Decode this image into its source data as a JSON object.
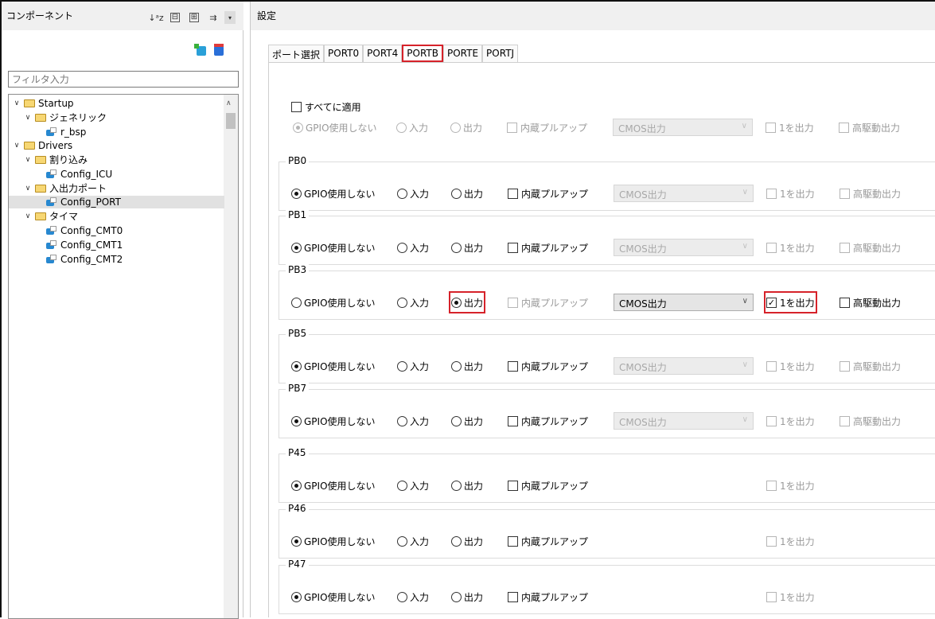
{
  "left_panel": {
    "title": "コンポーネント",
    "toolbar": {
      "sort": "↓ᵃz",
      "collapse": "⊟",
      "expand": "⊞",
      "link": "⇉",
      "menu": "▾"
    },
    "filter_placeholder": "フィルタ入力",
    "tree": [
      {
        "label": "Startup",
        "type": "folder"
      },
      {
        "label": "ジェネリック",
        "type": "folder"
      },
      {
        "label": "r_bsp",
        "type": "component"
      },
      {
        "label": "Drivers",
        "type": "folder"
      },
      {
        "label": "割り込み",
        "type": "folder"
      },
      {
        "label": "Config_ICU",
        "type": "component"
      },
      {
        "label": "入出力ポート",
        "type": "folder"
      },
      {
        "label": "Config_PORT",
        "type": "component",
        "selected": true
      },
      {
        "label": "タイマ",
        "type": "folder"
      },
      {
        "label": "Config_CMT0",
        "type": "component"
      },
      {
        "label": "Config_CMT1",
        "type": "component"
      },
      {
        "label": "Config_CMT2",
        "type": "component"
      }
    ]
  },
  "right_panel": {
    "title": "設定",
    "tabs": [
      "ポート選択",
      "PORT0",
      "PORT4",
      "PORTB",
      "PORTE",
      "PORTJ"
    ],
    "active_tab": "PORTB",
    "apply_all": {
      "label": "すべてに適用",
      "mode_none": "GPIO使用しない",
      "mode_in": "入力",
      "mode_out": "出力",
      "pullup": "内蔵プルアップ",
      "output_type": "CMOS出力",
      "out1": "1を出力",
      "high_drive": "高駆動出力"
    },
    "labels": {
      "mode_none": "GPIO使用しない",
      "mode_in": "入力",
      "mode_out": "出力",
      "pullup": "内蔵プルアップ",
      "output_type": "CMOS出力",
      "out1": "1を出力",
      "high_drive": "高駆動出力"
    },
    "pins": [
      {
        "name": "PB0",
        "mode": "none"
      },
      {
        "name": "PB1",
        "mode": "none"
      },
      {
        "name": "PB3",
        "mode": "output",
        "out1_checked": true
      },
      {
        "name": "PB5",
        "mode": "none"
      },
      {
        "name": "PB7",
        "mode": "none"
      },
      {
        "name": "P45",
        "mode": "none",
        "no_output_type": true
      },
      {
        "name": "P46",
        "mode": "none",
        "no_output_type": true
      },
      {
        "name": "P47",
        "mode": "none",
        "no_output_type": true
      }
    ]
  },
  "colors": {
    "highlight": "#d6222a",
    "selection": "#e1e1e1"
  }
}
